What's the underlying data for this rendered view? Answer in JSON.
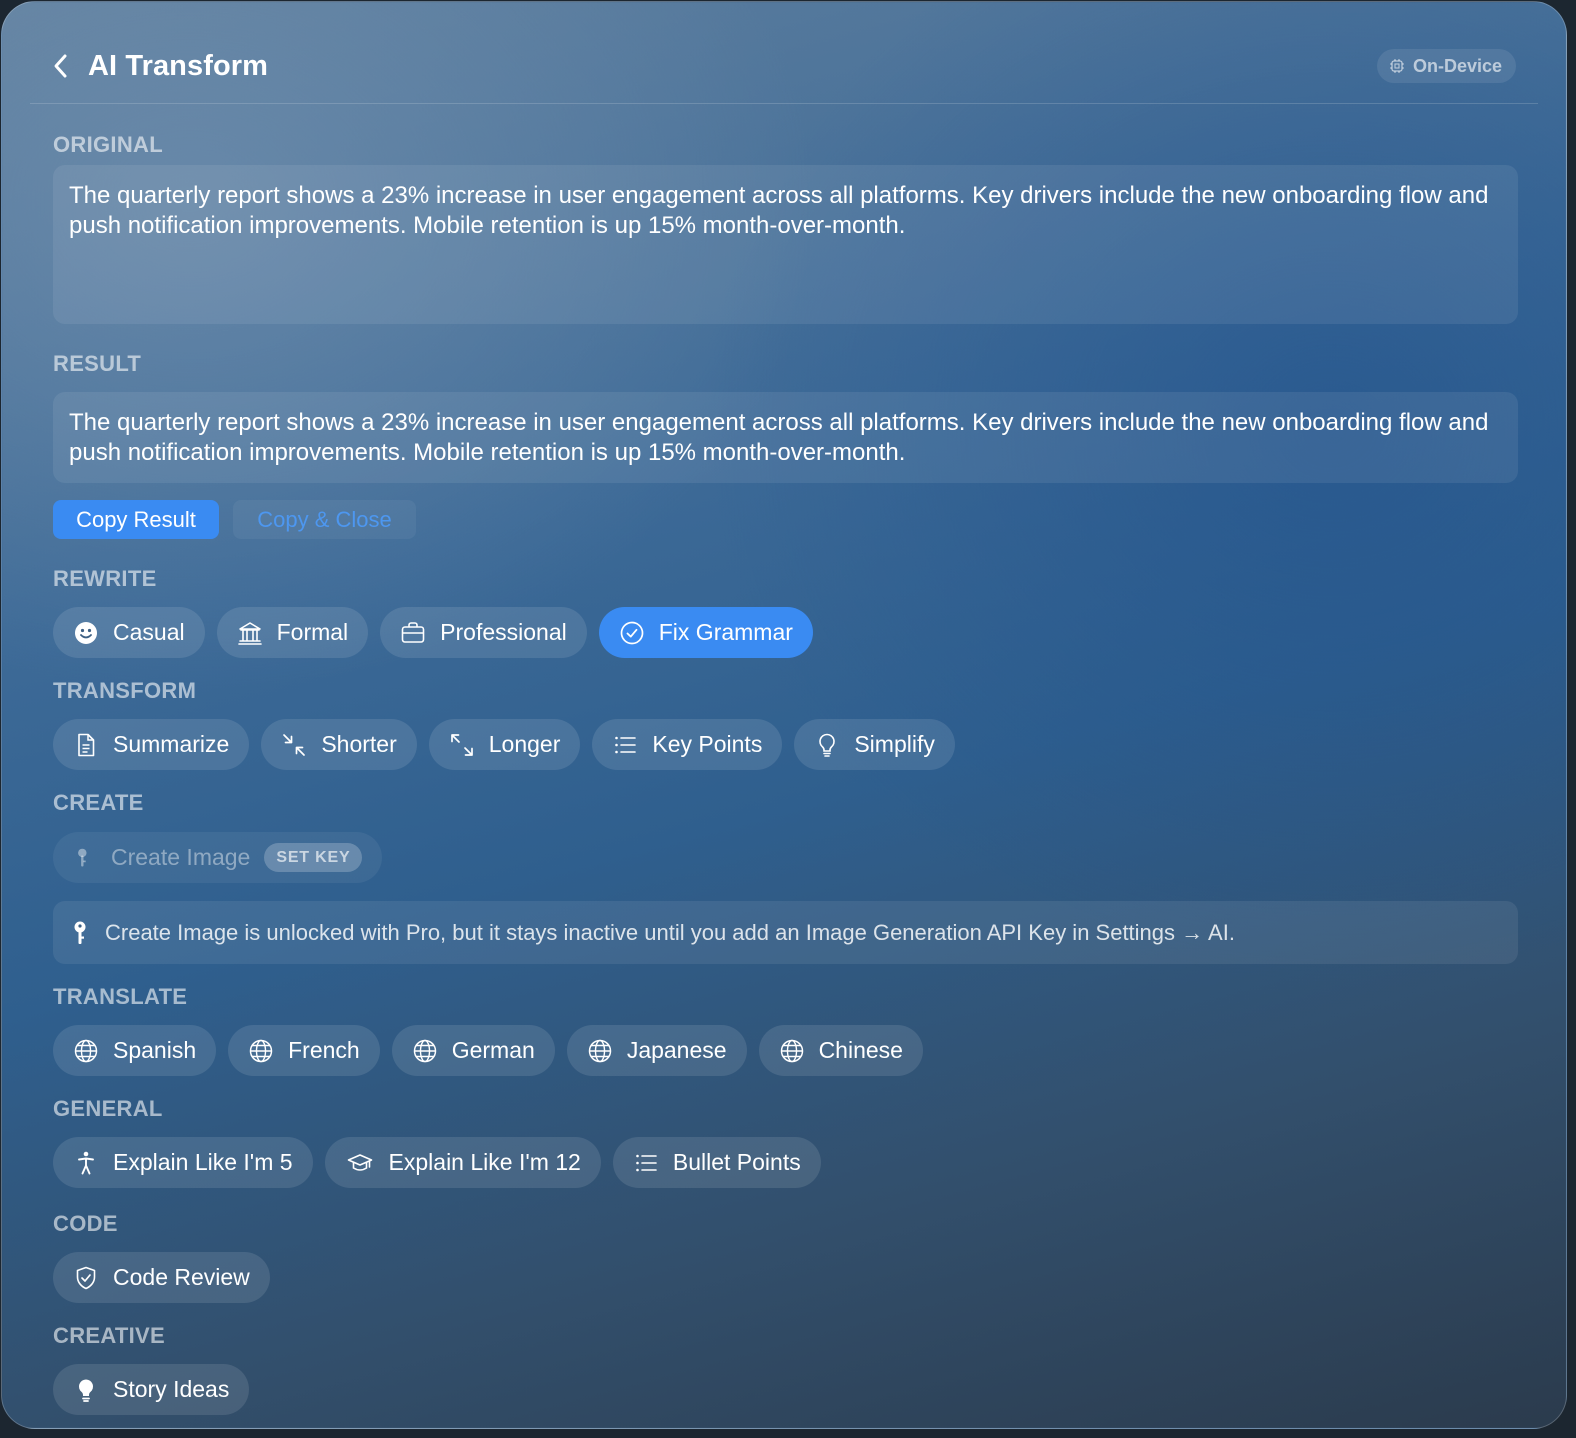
{
  "header": {
    "title": "AI Transform",
    "badge": "On-Device"
  },
  "original": {
    "label": "ORIGINAL",
    "text": "The quarterly report shows a 23% increase in user engagement across all platforms. Key drivers include the new onboarding flow and push notification improvements. Mobile retention is up 15% month-over-month."
  },
  "result": {
    "label": "RESULT",
    "text": "The quarterly report shows a 23% increase in user engagement across all platforms. Key drivers include the new onboarding flow and push notification improvements. Mobile retention is up 15% month-over-month."
  },
  "actions": {
    "copy_result": "Copy Result",
    "copy_close": "Copy & Close"
  },
  "rewrite": {
    "label": "REWRITE",
    "items": [
      {
        "label": "Casual",
        "icon": "smiley-icon"
      },
      {
        "label": "Formal",
        "icon": "building-columns-icon"
      },
      {
        "label": "Professional",
        "icon": "briefcase-icon"
      },
      {
        "label": "Fix Grammar",
        "icon": "checkmark-circle-icon",
        "active": true
      }
    ]
  },
  "transform": {
    "label": "TRANSFORM",
    "items": [
      {
        "label": "Summarize",
        "icon": "document-icon"
      },
      {
        "label": "Shorter",
        "icon": "arrows-collapse-icon"
      },
      {
        "label": "Longer",
        "icon": "arrows-expand-icon"
      },
      {
        "label": "Key Points",
        "icon": "list-icon"
      },
      {
        "label": "Simplify",
        "icon": "lightbulb-icon"
      }
    ]
  },
  "create": {
    "label": "CREATE",
    "item": {
      "label": "Create Image",
      "icon": "key-icon",
      "tag": "SET KEY"
    },
    "info": "Create Image is unlocked with Pro, but it stays inactive until you add an Image Generation API Key in Settings → AI."
  },
  "translate": {
    "label": "TRANSLATE",
    "items": [
      {
        "label": "Spanish",
        "icon": "globe-icon"
      },
      {
        "label": "French",
        "icon": "globe-icon"
      },
      {
        "label": "German",
        "icon": "globe-icon"
      },
      {
        "label": "Japanese",
        "icon": "globe-icon"
      },
      {
        "label": "Chinese",
        "icon": "globe-icon"
      }
    ]
  },
  "general": {
    "label": "GENERAL",
    "items": [
      {
        "label": "Explain Like I'm 5",
        "icon": "person-icon"
      },
      {
        "label": "Explain Like I'm 12",
        "icon": "graduation-cap-icon"
      },
      {
        "label": "Bullet Points",
        "icon": "list-icon"
      }
    ]
  },
  "code": {
    "label": "CODE",
    "items": [
      {
        "label": "Code Review",
        "icon": "shield-check-icon"
      }
    ]
  },
  "creative": {
    "label": "CREATIVE",
    "items": [
      {
        "label": "Story Ideas",
        "icon": "lightbulb-filled-icon"
      }
    ]
  },
  "colors": {
    "accent": "#3a8bf2",
    "link": "#4d97f0"
  }
}
